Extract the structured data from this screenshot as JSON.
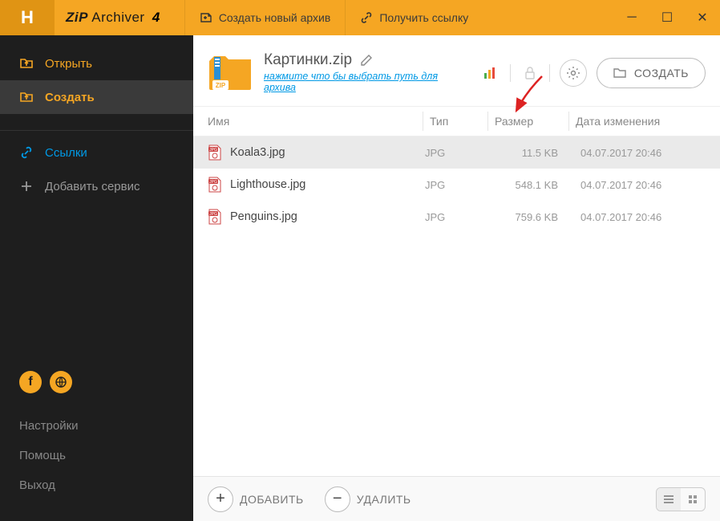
{
  "brand": {
    "zip": "ZiP",
    "archiver": "Archiver",
    "ver": "4"
  },
  "titleActions": {
    "create": "Создать новый архив",
    "link": "Получить ссылку"
  },
  "sidebar": {
    "open": "Открыть",
    "create": "Создать",
    "links": "Ссылки",
    "addService": "Добавить сервис",
    "settings": "Настройки",
    "help": "Помощь",
    "exit": "Выход"
  },
  "archive": {
    "name": "Картинки.zip",
    "pathHint": "нажмите что бы выбрать путь для архива",
    "createBtn": "СОЗДАТЬ"
  },
  "columns": {
    "name": "Имя",
    "type": "Тип",
    "size": "Размер",
    "date": "Дата изменения"
  },
  "files": [
    {
      "name": "Koala3.jpg",
      "type": "JPG",
      "size": "11.5 KB",
      "date": "04.07.2017 20:46",
      "selected": true
    },
    {
      "name": "Lighthouse.jpg",
      "type": "JPG",
      "size": "548.1 KB",
      "date": "04.07.2017 20:46",
      "selected": false
    },
    {
      "name": "Penguins.jpg",
      "type": "JPG",
      "size": "759.6 KB",
      "date": "04.07.2017 20:46",
      "selected": false
    }
  ],
  "footer": {
    "add": "ДОБАВИТЬ",
    "delete": "УДАЛИТЬ"
  }
}
